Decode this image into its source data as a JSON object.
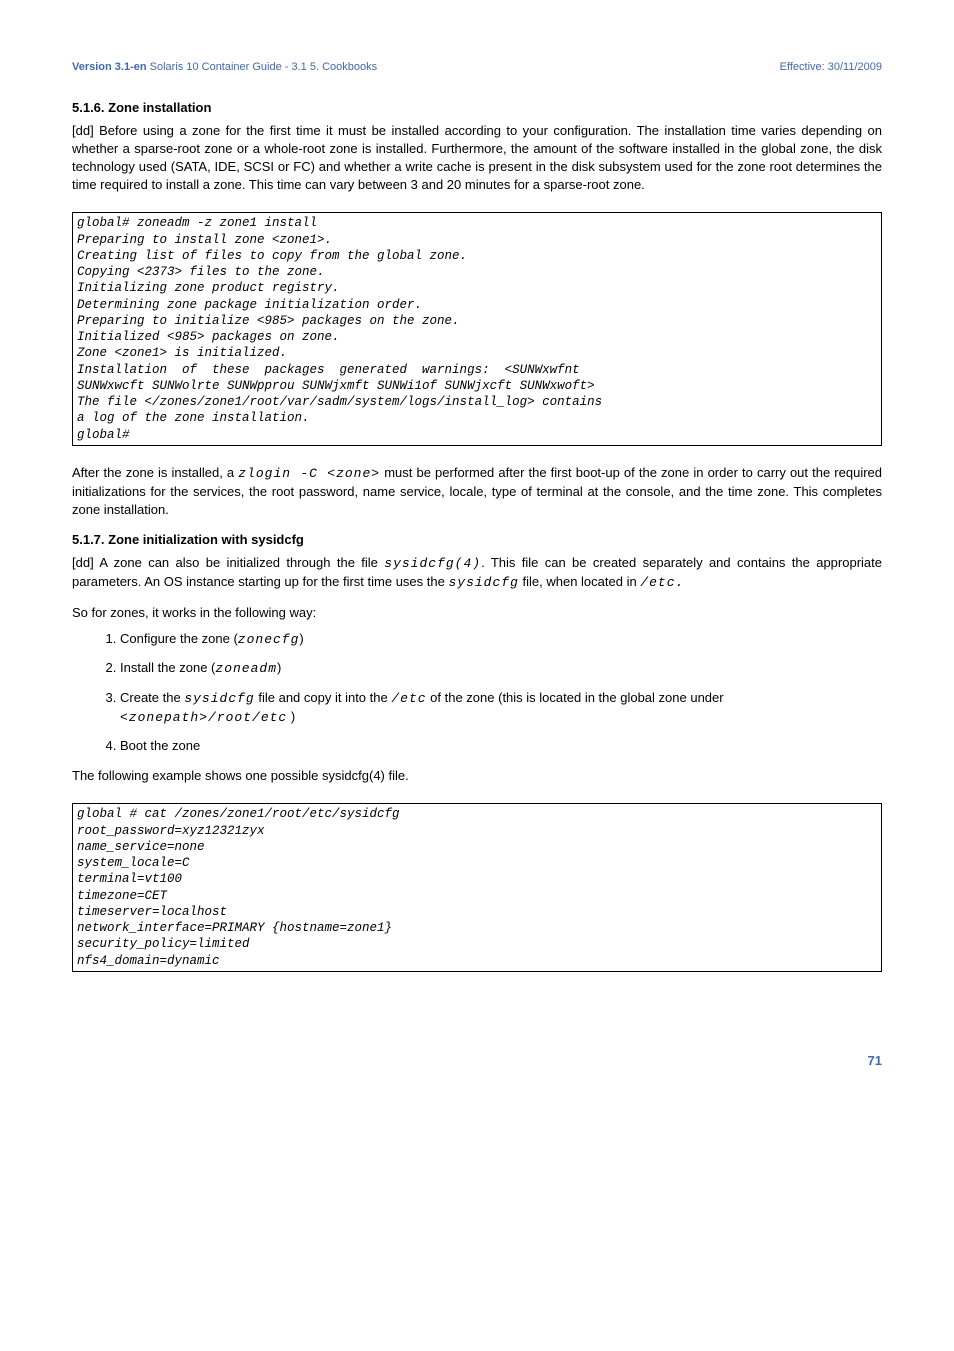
{
  "header": {
    "version": "Version 3.1-en",
    "title": "Solaris 10 Container Guide - 3.1  5. Cookbooks",
    "effective": "Effective: 30/11/2009"
  },
  "s516": {
    "heading": "5.1.6. Zone installation",
    "para": "[dd] Before using a zone for the first time it must be installed according to your configuration. The installation time varies depending on whether a sparse-root zone or a whole-root zone is installed. Furthermore, the amount of the software installed in the global zone, the disk technology used (SATA, IDE, SCSI or FC) and whether a write cache is present in the disk subsystem used for the zone root determines the time required to install a zone. This time can vary between 3 and 20 minutes for a sparse-root zone.",
    "code": "global# zoneadm -z zone1 install\nPreparing to install zone <zone1>.\nCreating list of files to copy from the global zone.\nCopying <2373> files to the zone.\nInitializing zone product registry.\nDetermining zone package initialization order.\nPreparing to initialize <985> packages on the zone.\nInitialized <985> packages on zone.\nZone <zone1> is initialized.\nInstallation  of  these  packages  generated  warnings:  <SUNWxwfnt\nSUNWxwcft SUNWolrte SUNWpprou SUNWjxmft SUNWi1of SUNWjxcft SUNWxwoft>\nThe file </zones/zone1/root/var/sadm/system/logs/install_log> contains\na log of the zone installation.\nglobal#",
    "after_para_1": "After the zone is installed, a ",
    "zlogin": "zlogin -C <zone>",
    "after_para_2": " must be performed after the first boot-up of the zone in order to carry out the required initializations for the services, the root password, name service, locale, type of terminal at the console, and the time zone. This completes zone installation."
  },
  "s517": {
    "heading": "5.1.7. Zone initialization with sysidcfg",
    "para1_a": "[dd] A zone can also be initialized through the file ",
    "sysidcfg4": "sysidcfg(4)",
    "para1_b": ". This file can be created separately and contains the appropriate parameters. An OS instance starting up for the first time uses the ",
    "sysidcfg": "sysidcfg",
    "para1_c": " file, when located in ",
    "etc": "/etc.",
    "para2": "So for zones, it works in the following way:",
    "li1_a": "Configure the zone (",
    "li1_cmd": "zonecfg",
    "li1_b": ")",
    "li2_a": "Install the zone (",
    "li2_cmd": "zoneadm",
    "li2_b": ")",
    "li3_a": "Create the ",
    "li3_cmd1": "sysidcfg",
    "li3_b": " file and copy it into the ",
    "li3_cmd2": "/etc",
    "li3_c": " of the zone (this is located in the global zone under ",
    "li3_cmd3": "<zonepath>/root/etc",
    "li3_d": " )",
    "li4": "Boot the zone",
    "para3": "The following example shows one possible sysidcfg(4) file.",
    "code": "global # cat /zones/zone1/root/etc/sysidcfg\nroot_password=xyz12321zyx\nname_service=none\nsystem_locale=C\nterminal=vt100\ntimezone=CET\ntimeserver=localhost\nnetwork_interface=PRIMARY {hostname=zone1}\nsecurity_policy=limited\nnfs4_domain=dynamic"
  },
  "page_number": "71"
}
